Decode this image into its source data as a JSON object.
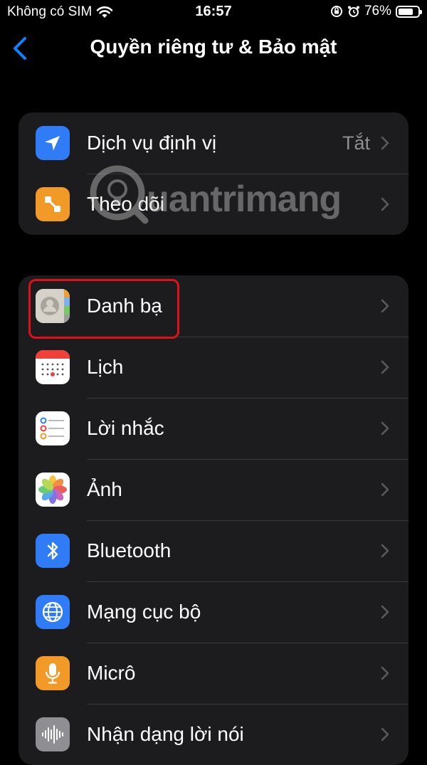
{
  "status_bar": {
    "carrier": "Không có SIM",
    "time": "16:57",
    "battery_percent": "76%",
    "battery_level": 0.76
  },
  "nav": {
    "title": "Quyền riêng tư & Bảo mật"
  },
  "group1": [
    {
      "label": "Dịch vụ định vị",
      "value": "Tắt",
      "icon": "location-arrow-icon",
      "color": "#2f7cf6"
    },
    {
      "label": "Theo dõi",
      "icon": "tracking-icon",
      "color": "#f29a28"
    }
  ],
  "group2": [
    {
      "label": "Danh bạ",
      "icon": "contacts-icon",
      "color": "#c9c5bd"
    },
    {
      "label": "Lịch",
      "icon": "calendar-icon",
      "color": "#ffffff"
    },
    {
      "label": "Lời nhắc",
      "icon": "reminders-icon",
      "color": "#ffffff"
    },
    {
      "label": "Ảnh",
      "icon": "photos-icon",
      "color": "#ffffff"
    },
    {
      "label": "Bluetooth",
      "icon": "bluetooth-icon",
      "color": "#2f7cf6"
    },
    {
      "label": "Mạng cục bộ",
      "icon": "globe-icon",
      "color": "#2f7cf6"
    },
    {
      "label": "Micrô",
      "icon": "microphone-icon",
      "color": "#f29a28"
    },
    {
      "label": "Nhận dạng lời nói",
      "icon": "speech-recognition-icon",
      "color": "#8e8e93"
    }
  ],
  "watermark": {
    "text": "uantrimang"
  },
  "colors": {
    "background": "#000000",
    "group_bg": "#1c1c1e",
    "accent": "#0a84ff",
    "highlight": "#e0101b"
  }
}
